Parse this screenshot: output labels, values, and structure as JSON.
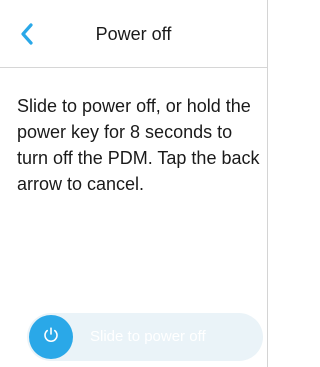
{
  "header": {
    "title": "Power off",
    "back_icon": "chevron-left-icon"
  },
  "message": "Slide to power off, or hold the power key for 8 seconds to turn off the PDM. Tap the back arrow to cancel.",
  "slider": {
    "label": "Slide to power off",
    "knob_icon": "power-icon",
    "progress": 0
  },
  "colors": {
    "accent": "#2aa8e8",
    "track": "#eaf3f8",
    "text": "#1a1a1a",
    "divider": "#d6d6d6"
  }
}
